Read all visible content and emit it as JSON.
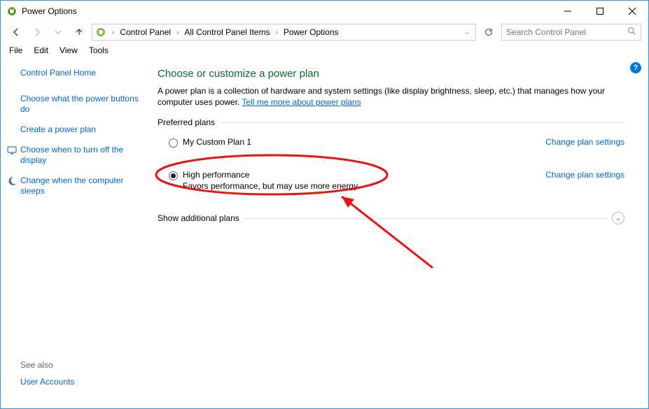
{
  "window": {
    "title": "Power Options"
  },
  "breadcrumb": {
    "control_panel": "Control Panel",
    "all_items": "All Control Panel Items",
    "power_options": "Power Options"
  },
  "search": {
    "placeholder": "Search Control Panel"
  },
  "menubar": {
    "file": "File",
    "edit": "Edit",
    "view": "View",
    "tools": "Tools"
  },
  "sidebar": {
    "home": "Control Panel Home",
    "links": [
      "Choose what the power buttons do",
      "Create a power plan",
      "Choose when to turn off the display",
      "Change when the computer sleeps"
    ],
    "see_also_label": "See also",
    "see_also_links": [
      "User Accounts"
    ]
  },
  "main": {
    "heading": "Choose or customize a power plan",
    "description_pre": "A power plan is a collection of hardware and system settings (like display brightness, sleep, etc.) that manages how your computer uses power. ",
    "description_link": "Tell me more about power plans",
    "preferred_label": "Preferred plans",
    "additional_label": "Show additional plans",
    "change_settings_label": "Change plan settings",
    "plans": [
      {
        "name": "My Custom Plan 1",
        "desc": "",
        "selected": false
      },
      {
        "name": "High performance",
        "desc": "Favors performance, but may use more energy.",
        "selected": true
      }
    ]
  },
  "colors": {
    "link": "#0066cc",
    "heading": "#0a6a2a",
    "annotation": "#e11"
  }
}
